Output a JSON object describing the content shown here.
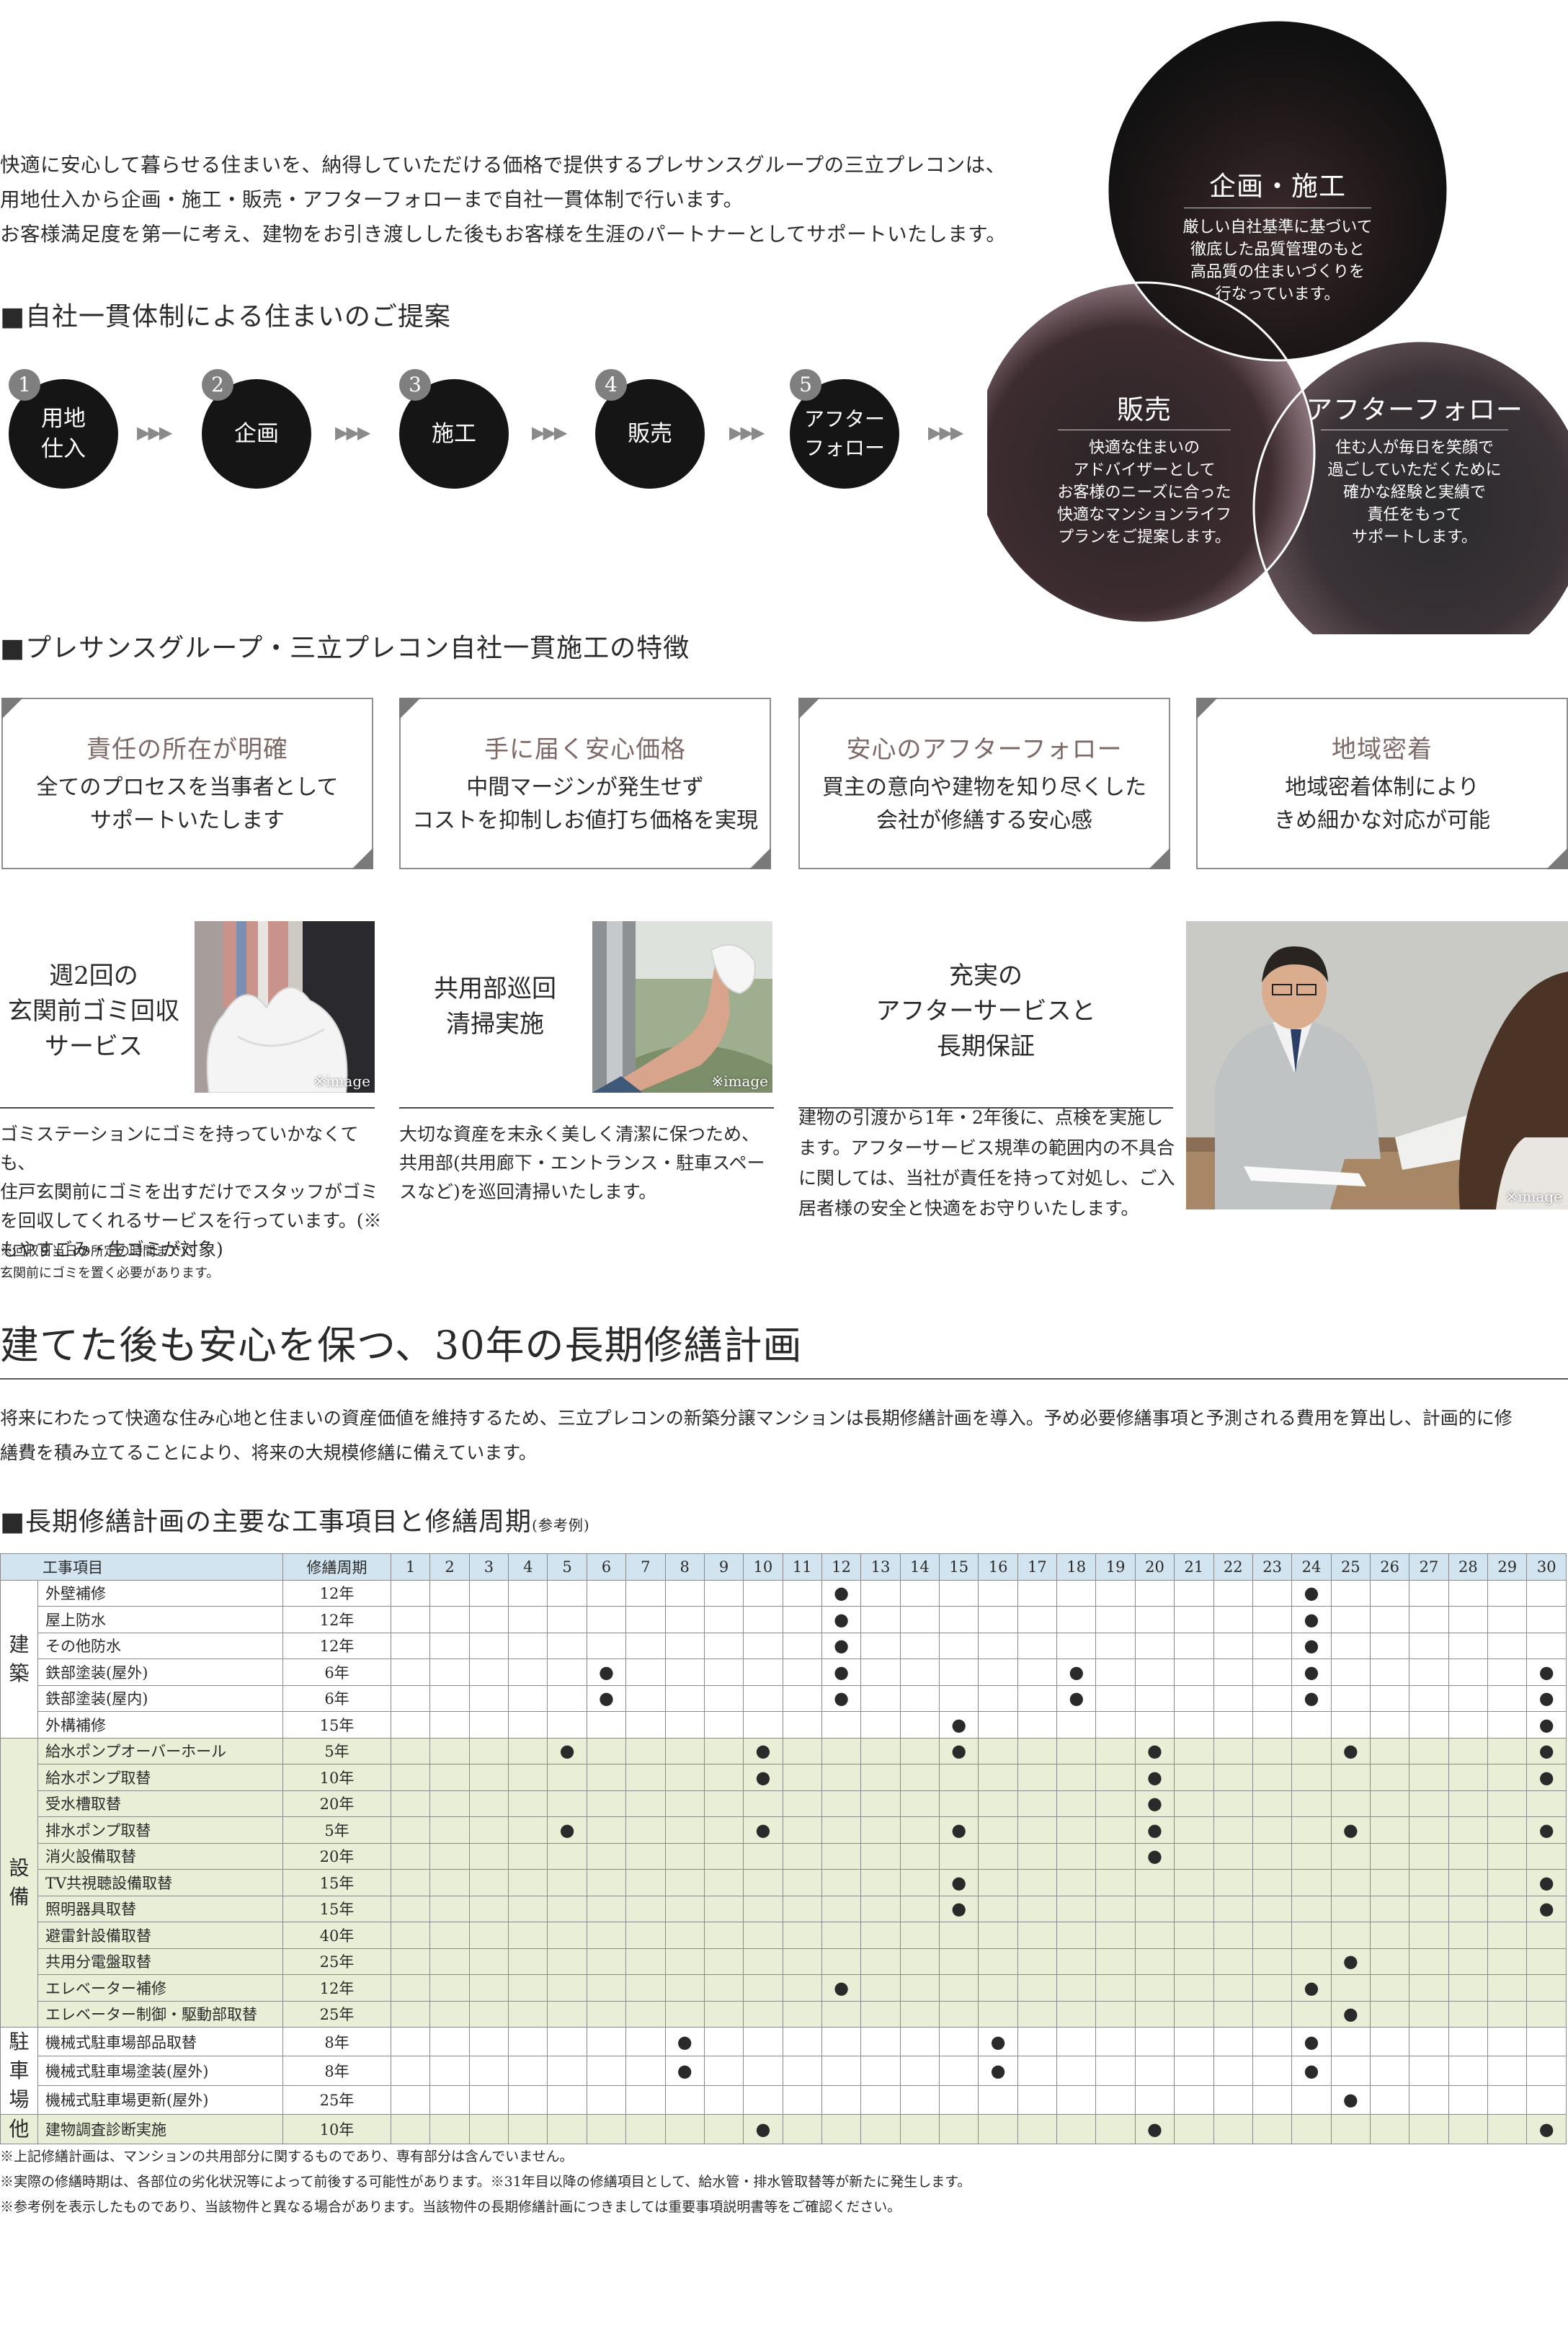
{
  "intro": [
    "快適に安心して暮らせる住まいを、納得していただける価格で提供するプレサンスグループの三立プレコンは、",
    "用地仕入から企画・施工・販売・アフターフォローまで自社一貫体制で行います。",
    "お客様満足度を第一に考え、建物をお引き渡しした後もお客様を生涯のパートナーとしてサポートいたします。"
  ],
  "section1_heading": "■自社一貫体制による住まいのご提案",
  "steps": [
    {
      "num": "1",
      "label": "用地\n仕入"
    },
    {
      "num": "2",
      "label": "企画"
    },
    {
      "num": "3",
      "label": "施工"
    },
    {
      "num": "4",
      "label": "販売"
    },
    {
      "num": "5",
      "label": "アフター\nフォロー"
    }
  ],
  "venn": {
    "planning": {
      "title": "企画・施工",
      "text": "厳しい自社基準に基づいて\n徹底した品質管理のもと\n高品質の住まいづくりを\n行なっています。"
    },
    "sales": {
      "title": "販売",
      "text": "快適な住まいの\nアドバイザーとして\nお客様のニーズに合った\n快適なマンションライフ\nプランをご提案します。"
    },
    "after": {
      "title": "アフターフォロー",
      "text": "住む人が毎日を笑顔で\n過ごしていただくために\n確かな経験と実績で\n責任をもって\nサポートします。"
    }
  },
  "section2_heading": "■プレサンスグループ・三立プレコン自社一貫施工の特徴",
  "features": [
    {
      "title": "責任の所在が明確",
      "text": "全てのプロセスを当事者として\nサポートいたします"
    },
    {
      "title": "手に届く安心価格",
      "text": "中間マージンが発生せず\nコストを抑制しお値打ち価格を実現"
    },
    {
      "title": "安心のアフターフォロー",
      "text": "買主の意向や建物を知り尽くした\n会社が修繕する安心感"
    },
    {
      "title": "地域密着",
      "text": "地域密着体制により\nきめ細かな対応が可能"
    }
  ],
  "services": [
    {
      "title": "週2回の\n玄関前ゴミ回収\nサービス",
      "desc": "ゴミステーションにゴミを持っていかなくても、\n住戸玄関前にゴミを出すだけでスタッフがゴミ\nを回収してくれるサービスを行っています。(※\nもやすごみ・生ゴミが対象)",
      "note": "※回収日当日の所定の時間までに\n玄関前にゴミを置く必要があります。"
    },
    {
      "title": "共用部巡回\n清掃実施",
      "desc": "大切な資産を末永く美しく清潔に保つため、\n共用部(共用廊下・エントランス・駐車スペー\nスなど)を巡回清掃いたします。"
    },
    {
      "title": "充実の\nアフターサービスと\n長期保証",
      "desc": "建物の引渡から1年・2年後に、点検を実施し\nます。アフターサービス規準の範囲内の不具合\nに関しては、当社が責任を持って対処し、ご入\n居者様の安全と快適をお守りいたします。"
    }
  ],
  "image_note": "※image",
  "plan_heading": "建てた後も安心を保つ、30年の長期修繕計画",
  "plan_text": [
    "将来にわたって快適な住み心地と住まいの資産価値を維持するため、三立プレコンの新築分譲マンションは長期修繕計画を導入。予め必要修繕事項と予測される費用を算出し、計画的に修",
    "繕費を積み立てることにより、将来の大規模修繕に備えています。"
  ],
  "table_heading": "■長期修繕計画の主要な工事項目と修繕周期",
  "table_heading_small": "(参考例)",
  "table": {
    "header_item": "工事項目",
    "header_cycle": "修繕周期",
    "years": [
      "1",
      "2",
      "3",
      "4",
      "5",
      "6",
      "7",
      "8",
      "9",
      "10",
      "11",
      "12",
      "13",
      "14",
      "15",
      "16",
      "17",
      "18",
      "19",
      "20",
      "21",
      "22",
      "23",
      "24",
      "25",
      "26",
      "27",
      "28",
      "29",
      "30"
    ],
    "mark": "●",
    "groups": [
      {
        "category": "建\n築",
        "shade": false,
        "rows": [
          {
            "item": "外壁補修",
            "cycle": "12年",
            "marks": [
              12,
              24
            ]
          },
          {
            "item": "屋上防水",
            "cycle": "12年",
            "marks": [
              12,
              24
            ]
          },
          {
            "item": "その他防水",
            "cycle": "12年",
            "marks": [
              12,
              24
            ]
          },
          {
            "item": "鉄部塗装(屋外)",
            "cycle": "6年",
            "marks": [
              6,
              12,
              18,
              24,
              30
            ]
          },
          {
            "item": "鉄部塗装(屋内)",
            "cycle": "6年",
            "marks": [
              6,
              12,
              18,
              24,
              30
            ]
          },
          {
            "item": "外構補修",
            "cycle": "15年",
            "marks": [
              15,
              30
            ]
          }
        ]
      },
      {
        "category": "設\n備",
        "shade": true,
        "rows": [
          {
            "item": "給水ポンプオーバーホール",
            "cycle": "5年",
            "marks": [
              5,
              10,
              15,
              20,
              25,
              30
            ]
          },
          {
            "item": "給水ポンプ取替",
            "cycle": "10年",
            "marks": [
              10,
              20,
              30
            ]
          },
          {
            "item": "受水槽取替",
            "cycle": "20年",
            "marks": [
              20
            ]
          },
          {
            "item": "排水ポンプ取替",
            "cycle": "5年",
            "marks": [
              5,
              10,
              15,
              20,
              25,
              30
            ]
          },
          {
            "item": "消火設備取替",
            "cycle": "20年",
            "marks": [
              20
            ]
          },
          {
            "item": "TV共視聴設備取替",
            "cycle": "15年",
            "marks": [
              15,
              30
            ]
          },
          {
            "item": "照明器具取替",
            "cycle": "15年",
            "marks": [
              15,
              30
            ]
          },
          {
            "item": "避雷針設備取替",
            "cycle": "40年",
            "marks": []
          },
          {
            "item": "共用分電盤取替",
            "cycle": "25年",
            "marks": [
              25
            ]
          },
          {
            "item": "エレベーター補修",
            "cycle": "12年",
            "marks": [
              12,
              24
            ]
          },
          {
            "item": "エレベーター制御・駆動部取替",
            "cycle": "25年",
            "marks": [
              25
            ]
          }
        ]
      },
      {
        "category": "駐\n車\n場",
        "shade": false,
        "rows": [
          {
            "item": "機械式駐車場部品取替",
            "cycle": "8年",
            "marks": [
              8,
              16,
              24
            ]
          },
          {
            "item": "機械式駐車場塗装(屋外)",
            "cycle": "8年",
            "marks": [
              8,
              16,
              24
            ]
          },
          {
            "item": "機械式駐車場更新(屋外)",
            "cycle": "25年",
            "marks": [
              25
            ]
          }
        ]
      },
      {
        "category": "他",
        "shade": true,
        "rows": [
          {
            "item": "建物調査診断実施",
            "cycle": "10年",
            "marks": [
              10,
              20,
              30
            ]
          }
        ]
      }
    ]
  },
  "footnotes": [
    "※上記修繕計画は、マンションの共用部分に関するものであり、専有部分は含んでいません。",
    "※実際の修繕時期は、各部位の劣化状況等によって前後する可能性があります。※31年目以降の修繕項目として、給水管・排水管取替等が新たに発生します。",
    "※参考例を表示したものであり、当該物件と異なる場合があります。当該物件の長期修繕計画につきましては重要事項説明書等をご確認ください。"
  ],
  "colors": {
    "table_header": "#d3e4f1",
    "table_shade": "#e9efd6",
    "feature_title": "#7d6a66",
    "step_circle": "#151515"
  }
}
